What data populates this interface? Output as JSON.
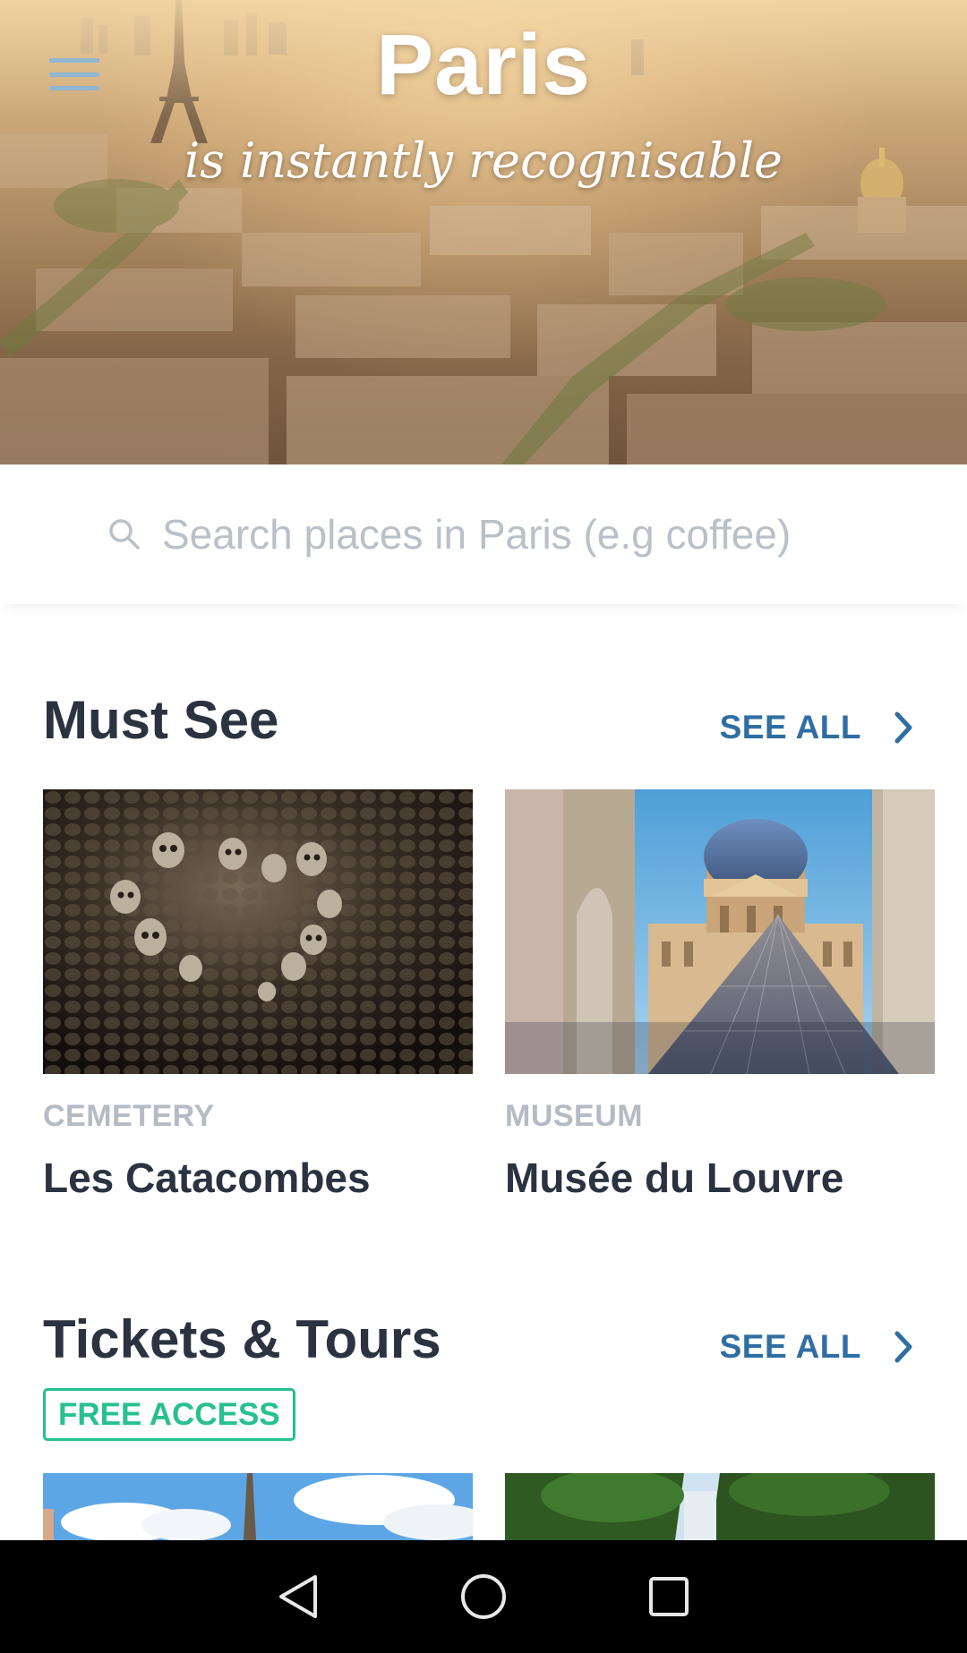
{
  "hero": {
    "title": "Paris",
    "subtitle": "is instantly recognisable"
  },
  "icons": {
    "menu": "menu-icon",
    "search": "search-icon",
    "chevron": "chevron-right-icon",
    "back": "back-triangle-icon",
    "home": "home-circle-icon",
    "recents": "recents-square-icon"
  },
  "search": {
    "placeholder": "Search places in Paris (e.g coffee)"
  },
  "must_see": {
    "title": "Must See",
    "see_all": "SEE ALL",
    "cards": [
      {
        "category": "CEMETERY",
        "name": "Les Catacombes"
      },
      {
        "category": "MUSEUM",
        "name": "Musée du Louvre"
      }
    ]
  },
  "tickets": {
    "title": "Tickets & Tours",
    "see_all": "SEE ALL",
    "badge": "FREE ACCESS"
  },
  "colors": {
    "accent_link": "#2f6ea2",
    "badge_green": "#27c08f",
    "text_dark": "#2b3240",
    "category_gray": "#b4bbc3"
  }
}
